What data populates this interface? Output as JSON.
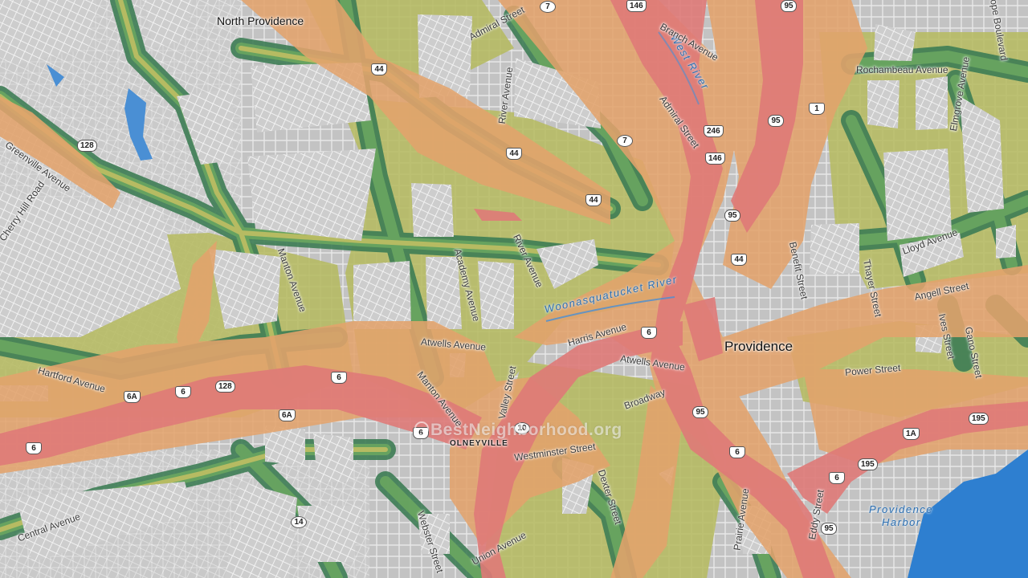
{
  "map": {
    "watermark": "BestNeighborhood.org",
    "places": {
      "providence": "Providence",
      "north_providence": "North Providence",
      "olneyville": "OLNEYVILLE"
    },
    "water": {
      "west_river": "West River",
      "woonasquatucket_river": "Woonasquatucket River",
      "providence_harbor_line1": "Providence",
      "providence_harbor_line2": "Harbor"
    },
    "streets": {
      "admiral_street_top": "Admiral Street",
      "admiral_street_mid": "Admiral Street",
      "branch_avenue": "Branch Avenue",
      "river_avenue_top": "River Avenue",
      "river_avenue_mid": "River Avenue",
      "greenville_avenue": "Greenville Avenue",
      "cherry_hill_road": "Cherry Hill Road",
      "manton_avenue_top": "Manton Avenue",
      "manton_avenue_bottom": "Manton Avenue",
      "academy_avenue": "Academy Avenue",
      "atwells_avenue_left": "Atwells Avenue",
      "atwells_avenue_right": "Atwells Avenue",
      "harris_avenue": "Harris Avenue",
      "valley_street": "Valley Street",
      "hartford_avenue": "Hartford Avenue",
      "central_avenue": "Central Avenue",
      "webster_street": "Webster Street",
      "union_avenue": "Union Avenue",
      "westminster_street": "Westminster Street",
      "dexter_street": "Dexter Street",
      "broadway": "Broadway",
      "prairie_avenue": "Prairie Avenue",
      "eddy_street": "Eddy Street",
      "benefit_street": "Benefit Street",
      "thayer_street": "Thayer Street",
      "lloyd_avenue": "Lloyd Avenue",
      "angell_street": "Angell Street",
      "ives_street": "Ives Street",
      "gano_street": "Gano Street",
      "power_street": "Power Street",
      "rochambeau_avenue": "Rochambeau Avenue",
      "elmgrove_avenue": "Elmgrove Avenue",
      "hope_boulevard": "Hope Boulevard"
    },
    "shields": {
      "i95_a": "95",
      "i95_b": "95",
      "i95_c": "95",
      "i95_d": "95",
      "i195_a": "195",
      "i195_b": "195",
      "r146_a": "146",
      "r146_b": "146",
      "r246": "246",
      "r44_a": "44",
      "r44_b": "44",
      "r44_c": "44",
      "r44_d": "44",
      "r7_a": "7",
      "r7_b": "7",
      "r128_a": "128",
      "r128_b": "128",
      "r6_a": "6",
      "r6_b": "6",
      "r6_c": "6",
      "r6_d": "6",
      "r6_e": "6",
      "r6_f": "6",
      "r6_g": "6",
      "r6a_a": "6A",
      "r6a_b": "6A",
      "r1": "1",
      "r1a": "1A",
      "r10": "10",
      "r14": "14"
    },
    "colors": {
      "base_gray": "#9a9a9a",
      "dark_green": "#3e7d55",
      "green": "#6aa660",
      "yellow_green": "#b6bb62",
      "orange": "#e3a36c",
      "red": "#df7a78",
      "water": "#2e7fd0"
    }
  }
}
